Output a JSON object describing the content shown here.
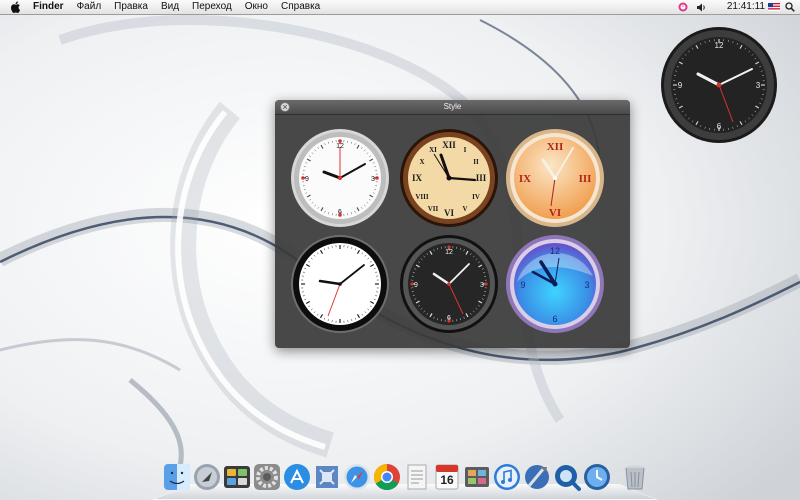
{
  "menubar": {
    "app_name": "Finder",
    "menus": [
      "Файл",
      "Правка",
      "Вид",
      "Переход",
      "Окно",
      "Справка"
    ],
    "clock_time": "21:41:11",
    "status_icons": [
      "clock-app-icon",
      "volume-icon",
      "flag-icon",
      "spotlight-search-icon"
    ]
  },
  "style_panel": {
    "title": "Style",
    "options": [
      {
        "name": "silver-clock",
        "face": "#f7f7f7",
        "rim": "#c9c9c9",
        "numerals": "arabic"
      },
      {
        "name": "antique-roman-clock",
        "face": "#f2d7a4",
        "rim": "#6b3a1b",
        "numerals": "roman"
      },
      {
        "name": "orange-roman-clock",
        "face": "#f4b774",
        "rim": "#e3c9a3",
        "numerals": "roman"
      },
      {
        "name": "black-white-clock",
        "face": "#ffffff",
        "rim": "#111111",
        "numerals": "none"
      },
      {
        "name": "dark-clock",
        "face": "#2b2b2b",
        "rim": "#1a1a1a",
        "numerals": "arabic"
      },
      {
        "name": "blue-glass-clock",
        "face": "#5fb3ff",
        "rim": "#b59ad6",
        "numerals": "arabic"
      }
    ]
  },
  "desktop_widget": {
    "name": "desktop-clock-widget",
    "style": "dark"
  },
  "dock": {
    "items": [
      "finder-icon",
      "launchpad-icon",
      "dashboard-icon",
      "system-preferences-icon",
      "app-store-icon",
      "mail-icon",
      "safari-icon",
      "chrome-icon",
      "textedit-icon",
      "calendar-icon",
      "photo-booth-icon",
      "itunes-icon",
      "xcode-icon",
      "quicktime-icon",
      "time-machine-icon",
      "trash-icon"
    ],
    "calendar_day": "16"
  },
  "colors": {
    "panel_bg": "#3a3a3a",
    "accent_red": "#d9342b",
    "menubar_bg": "#eeeeee"
  }
}
